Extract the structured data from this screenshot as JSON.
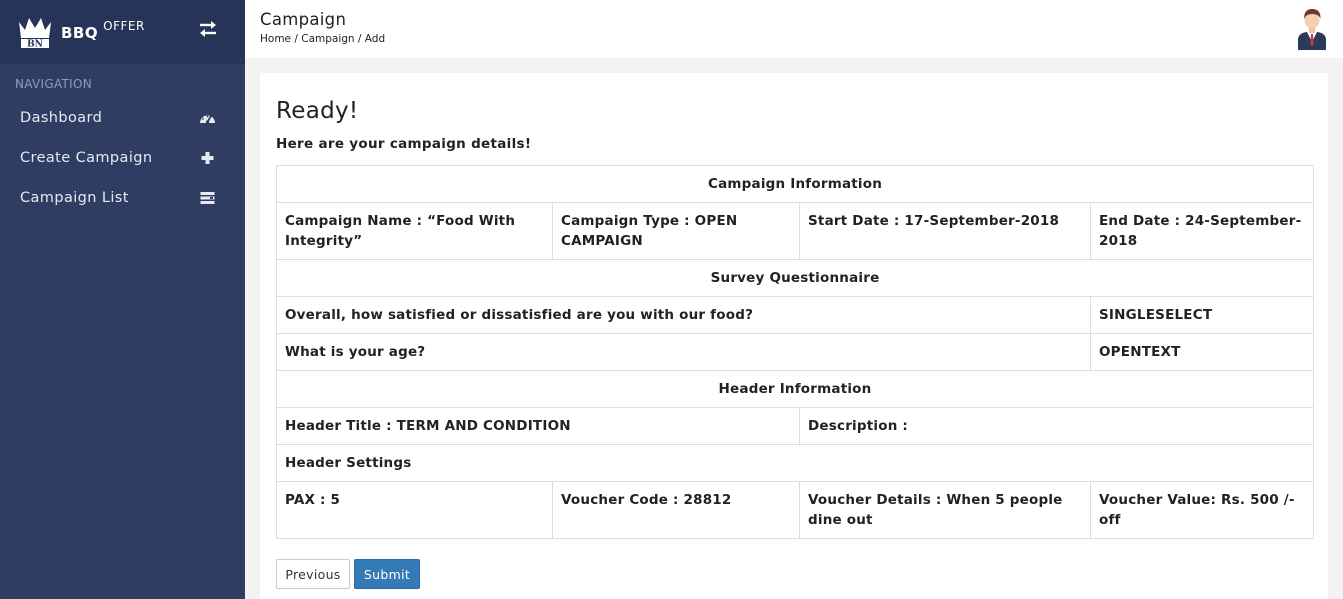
{
  "brand": {
    "name": "BBQ",
    "suffix": "OFFER",
    "logo_text": "BN"
  },
  "sidebar": {
    "heading": "NAVIGATION",
    "items": [
      {
        "label": "Dashboard",
        "icon": "dashboard-icon"
      },
      {
        "label": "Create Campaign",
        "icon": "plus-icon"
      },
      {
        "label": "Campaign List",
        "icon": "list-icon"
      }
    ]
  },
  "header": {
    "title": "Campaign",
    "breadcrumb": [
      "Home",
      "Campaign",
      "Add"
    ],
    "separator": " / "
  },
  "main": {
    "heading": "Ready!",
    "subtitle": "Here are your campaign details!",
    "sections": {
      "campaign_info": "Campaign Information",
      "survey": "Survey Questionnaire",
      "header_info": "Header Information",
      "header_settings": "Header Settings"
    },
    "campaign": {
      "name": "Campaign Name : “Food With Integrity”",
      "type": "Campaign Type : OPEN CAMPAIGN",
      "start": "Start Date : 17-September-2018",
      "end": "End Date : 24-September-2018"
    },
    "questions": [
      {
        "text": "Overall, how satisfied or dissatisfied are you with our food?",
        "type": "SINGLESELECT"
      },
      {
        "text": "What is your age?",
        "type": "OPENTEXT"
      }
    ],
    "header_fields": {
      "title": "Header Title : TERM AND CONDITION",
      "description": "Description :"
    },
    "settings": {
      "pax": "PAX : 5",
      "voucher_code": "Voucher Code : 28812",
      "voucher_details": "Voucher Details : When 5 people dine out",
      "voucher_value": "Voucher Value: Rs. 500 /- off"
    },
    "buttons": {
      "previous": "Previous",
      "submit": "Submit"
    }
  },
  "colors": {
    "sidebar_bg": "#2f3d63",
    "brand_bg": "#27345a",
    "primary": "#337ab7"
  }
}
